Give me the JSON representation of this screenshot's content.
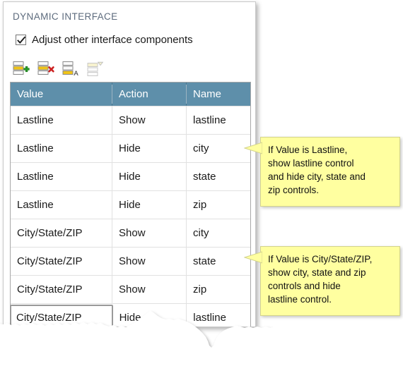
{
  "panel": {
    "title": "DYNAMIC INTERFACE",
    "checkbox": {
      "label": "Adjust other interface components",
      "checked": true,
      "icon": "checkmark-icon"
    },
    "toolbar": {
      "buttons": [
        {
          "name": "add-row-button",
          "icon": "rows-plus-icon",
          "badge": "+"
        },
        {
          "name": "delete-row-button",
          "icon": "rows-delete-icon",
          "badge": "×"
        },
        {
          "name": "sort-rows-button",
          "icon": "rows-sort-icon",
          "badge": "A"
        },
        {
          "name": "filter-rows-button",
          "icon": "rows-filter-icon",
          "badge": "▼"
        }
      ]
    }
  },
  "table": {
    "columns": [
      "Value",
      "Action",
      "Name"
    ],
    "rows": [
      {
        "value": "Lastline",
        "action": "Show",
        "name": "lastline",
        "selected": false
      },
      {
        "value": "Lastline",
        "action": "Hide",
        "name": "city",
        "selected": false
      },
      {
        "value": "Lastline",
        "action": "Hide",
        "name": "state",
        "selected": false
      },
      {
        "value": "Lastline",
        "action": "Hide",
        "name": "zip",
        "selected": false
      },
      {
        "value": "City/State/ZIP",
        "action": "Show",
        "name": "city",
        "selected": false
      },
      {
        "value": "City/State/ZIP",
        "action": "Show",
        "name": "state",
        "selected": false
      },
      {
        "value": "City/State/ZIP",
        "action": "Show",
        "name": "zip",
        "selected": false
      },
      {
        "value": "City/State/ZIP",
        "action": "Hide",
        "name": "lastline",
        "selected": true
      }
    ]
  },
  "callouts": [
    {
      "name": "callout-lastline",
      "line1": "If Value is Lastline,",
      "line2": "show lastline control",
      "line3": "and hide city, state and",
      "line4": "zip controls."
    },
    {
      "name": "callout-city-state-zip",
      "line1": "If Value is City/State/ZIP,",
      "line2": "show city, state and zip",
      "line3": "controls and hide",
      "line4": "lastline control."
    }
  ],
  "colors": {
    "header_background": "#5e8faa",
    "header_text": "#ffffff",
    "callout_background": "#ffffa0",
    "callout_border": "#d3d38c",
    "title_text": "#5d6b7d",
    "row_separator": "#e1e1e1",
    "icon_highlight": "#f0c419",
    "badge_add": "#2aa02a",
    "badge_delete": "#cc2222"
  }
}
